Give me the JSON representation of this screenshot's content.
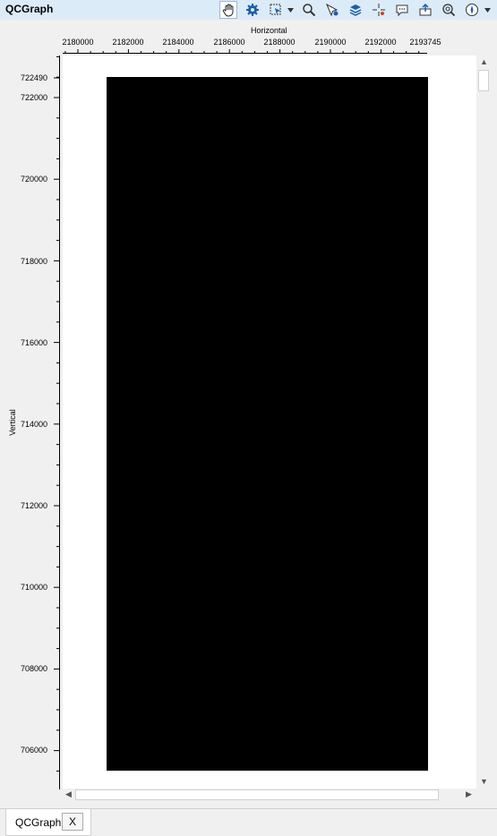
{
  "app": {
    "title": "QCGraph"
  },
  "toolbar": {
    "tools": [
      {
        "name": "pan-hand-icon",
        "active": true
      },
      {
        "name": "gear-icon",
        "active": false
      },
      {
        "name": "select-region-icon",
        "active": false,
        "dropdown": true
      },
      {
        "name": "zoom-magnifier-icon",
        "active": false
      },
      {
        "name": "pointer-probe-icon",
        "active": false
      },
      {
        "name": "layers-icon",
        "active": false
      },
      {
        "name": "crosshair-icon",
        "active": false
      },
      {
        "name": "comment-icon",
        "active": false
      },
      {
        "name": "export-icon",
        "active": false
      },
      {
        "name": "zoom-fit-icon",
        "active": false
      },
      {
        "name": "compass-icon",
        "active": false,
        "dropdown": true
      }
    ]
  },
  "graph": {
    "x_axis_title": "Horizontal",
    "y_axis_title": "Vertical",
    "x_ticks": [
      "2180000",
      "2182000",
      "2184000",
      "2186000",
      "2188000",
      "2190000",
      "2192000",
      "2193745"
    ],
    "y_ticks": [
      "722490",
      "722000",
      "720000",
      "718000",
      "716000",
      "714000",
      "712000",
      "710000",
      "708000",
      "706000"
    ],
    "data_fill_color": "#000000",
    "plot_background": "#ffffff"
  },
  "tabs": [
    {
      "label": "QCGraph",
      "close_label": "X"
    }
  ]
}
